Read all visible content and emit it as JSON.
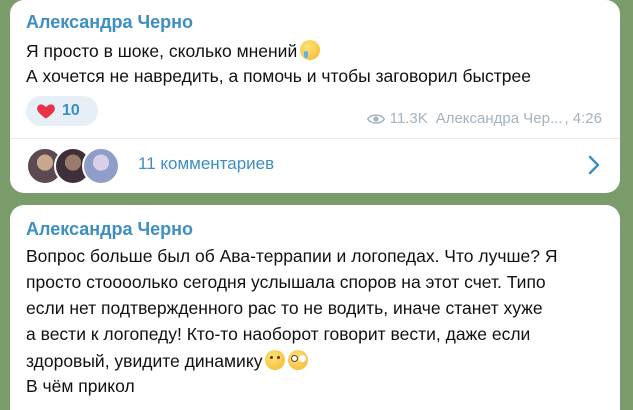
{
  "colors": {
    "accent": "#3d8ec2",
    "bubble": "#ffffff",
    "background": "#7a9b6a",
    "meta": "#a3b3bf"
  },
  "messages": [
    {
      "author": "Александра Черно",
      "lines": [
        "Я просто в шоке, сколько мнений",
        "А хочется не навредить, а помочь и чтобы заговорил быстрее"
      ],
      "emoji_icons": [
        "crying-face-icon"
      ],
      "reaction": {
        "icon": "heart-icon",
        "count": "10"
      },
      "views": "11.3K",
      "signature": "Александра Чер...",
      "time": "4:26",
      "comments_label": "11 комментариев"
    },
    {
      "author": "Александра Черно",
      "lines": [
        "Вопрос больше был об Ава-террапии и логопедах. Что лучше? Я",
        "просто стоооолько сегодня услышала споров на этот счет. Типо",
        "если нет подтвержденного рас то не водить, иначе станет хуже",
        "а вести к логопеду! Кто-то наоборот говорит вести, даже если",
        "здоровый, увидите динамику",
        "В чём прикол"
      ],
      "emoji_icons": [
        "side-eye-face-icon",
        "flushed-face-icon"
      ]
    }
  ]
}
